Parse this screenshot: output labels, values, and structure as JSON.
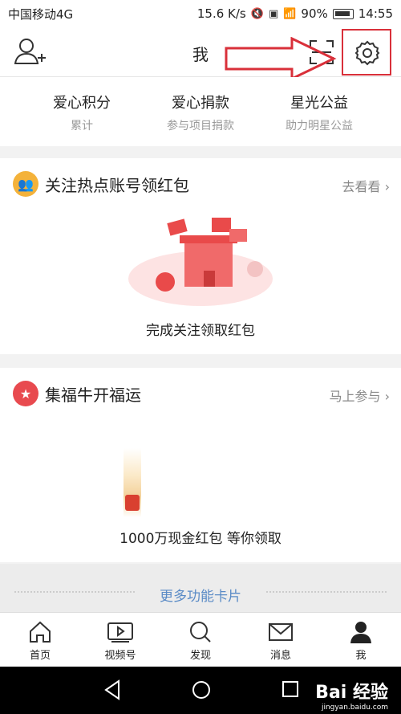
{
  "status_bar": {
    "carrier": "中国移动4G",
    "speed": "15.6 K/s",
    "battery": "90%",
    "time": "14:55"
  },
  "header": {
    "title": "我"
  },
  "stats": [
    {
      "label": "爱心积分",
      "sub": "累计"
    },
    {
      "label": "爱心捐款",
      "sub": "参与项目捐款"
    },
    {
      "label": "星光公益",
      "sub": "助力明星公益"
    }
  ],
  "cards": [
    {
      "title": "关注热点账号领红包",
      "link": "去看看",
      "caption": "完成关注领取红包",
      "badge_color": "#f4b23a"
    },
    {
      "title": "集福牛开福运",
      "link": "马上参与",
      "caption": "1000万现金红包 等你领取",
      "badge_color": "#e84a4f"
    }
  ],
  "more": {
    "label": "更多功能卡片"
  },
  "tabbar": [
    {
      "label": "首页",
      "icon": "home-icon"
    },
    {
      "label": "视频号",
      "icon": "video-icon"
    },
    {
      "label": "发现",
      "icon": "discover-icon"
    },
    {
      "label": "消息",
      "icon": "message-icon"
    },
    {
      "label": "我",
      "icon": "profile-icon"
    }
  ],
  "watermark": {
    "text": "Bai 经验",
    "sub": "jingyan.baidu.com"
  },
  "colors": {
    "accent_red": "#d9303a",
    "link_blue": "#5a8bc6"
  }
}
